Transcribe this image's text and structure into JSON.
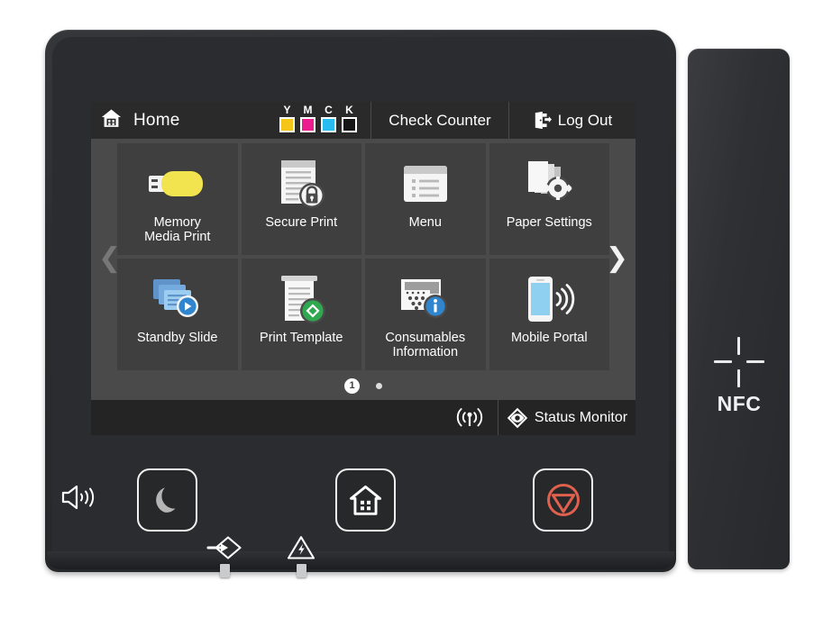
{
  "device": {
    "nfc": {
      "label": "NFC",
      "icon": "nfc-cross-icon"
    }
  },
  "screen": {
    "header": {
      "home_icon": "home-icon",
      "title": "Home",
      "toner": [
        {
          "label": "Y",
          "color": "#f5c518",
          "level": 100
        },
        {
          "label": "M",
          "color": "#ec1d8e",
          "level": 100
        },
        {
          "label": "C",
          "color": "#29bdef",
          "level": 100
        },
        {
          "label": "K",
          "color": "#151515",
          "level": 100
        }
      ],
      "check_counter": "Check Counter",
      "log_out": "Log Out",
      "log_out_icon": "log-out-icon"
    },
    "tiles": [
      {
        "label": "Memory\nMedia Print",
        "icon": "usb-drive-icon"
      },
      {
        "label": "Secure Print",
        "icon": "document-lock-icon"
      },
      {
        "label": "Menu",
        "icon": "list-window-icon"
      },
      {
        "label": "Paper Settings",
        "icon": "paper-stack-gear-icon"
      },
      {
        "label": "Standby Slide",
        "icon": "slides-play-icon"
      },
      {
        "label": "Print Template",
        "icon": "printout-green-diamond-icon"
      },
      {
        "label": "Consumables\nInformation",
        "icon": "toner-cartridge-info-icon"
      },
      {
        "label": "Mobile Portal",
        "icon": "smartphone-wireless-icon"
      }
    ],
    "nav": {
      "prev_icon": "chevron-left-icon",
      "next_icon": "chevron-right-icon"
    },
    "pager": {
      "current": "1",
      "pages": 2
    },
    "footer": {
      "wifi_icon": "wireless-signal-icon",
      "status_icon": "status-monitor-diamond-icon",
      "status_label": "Status Monitor"
    }
  },
  "hardware": {
    "speaker_icon": "speaker-volume-icon",
    "buttons": [
      {
        "name": "sleep",
        "icon": "crescent-moon-icon"
      },
      {
        "name": "home",
        "icon": "house-icon"
      },
      {
        "name": "stop",
        "icon": "stop-sign-icon"
      }
    ],
    "indicators": [
      {
        "name": "data",
        "icon": "data-arrow-diamond-icon"
      },
      {
        "name": "error",
        "icon": "warning-triangle-icon"
      }
    ]
  },
  "colors": {
    "screen_bg": "#1d1d1d",
    "tile_bg": "#3f3f3f",
    "tile_area_bg": "#4a4a4a",
    "topbar_bg": "#2a2a2a",
    "botbar_bg": "#242424",
    "accent_blue": "#2f9fe0",
    "accent_green": "#29a745",
    "accent_red": "#e05a4a",
    "yellow": "#f5c518"
  }
}
